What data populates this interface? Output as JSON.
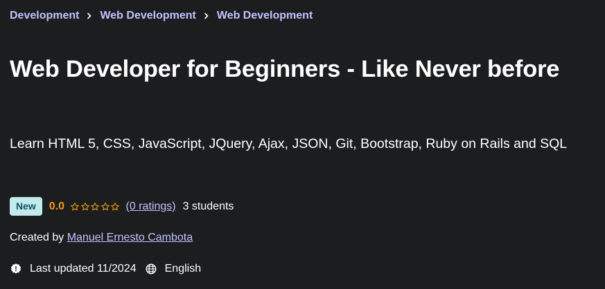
{
  "breadcrumb": {
    "items": [
      "Development",
      "Web Development",
      "Web Development"
    ]
  },
  "course": {
    "title": "Web Developer for Beginners - Like Never before",
    "subtitle": "Learn HTML 5, CSS, JavaScript, JQuery, Ajax, JSON, Git, Bootstrap, Ruby on Rails and SQL"
  },
  "meta": {
    "badge": "New",
    "rating_value": "0.0",
    "stars_filled": 0,
    "stars_total": 5,
    "ratings_link": "(0 ratings)",
    "students": "3 students"
  },
  "created": {
    "prefix": "Created by",
    "author": "Manuel Ernesto Cambota"
  },
  "info": {
    "last_updated": "Last updated 11/2024",
    "language": "English"
  },
  "icons": {
    "separator": "chevron-right-icon",
    "star": "star-outline-icon",
    "updated": "alert-badge-icon",
    "language": "globe-icon"
  },
  "colors": {
    "background": "#1c1d1f",
    "link": "#c0c4fc",
    "rating": "#f69c08",
    "badge_bg": "#c2e9eb",
    "badge_text": "#0d5261"
  }
}
